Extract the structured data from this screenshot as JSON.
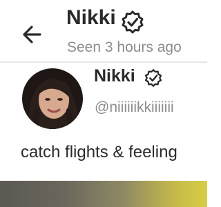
{
  "header": {
    "back_icon": "arrow-left-icon",
    "name": "Nikki",
    "verified_icon": "verified-badge-icon",
    "status": "Seen  3 hours ago"
  },
  "profile": {
    "avatar_icon": "avatar",
    "name": "Nikki",
    "verified_icon": "verified-badge-icon",
    "handle": "@niiiiiikkiiiiiii",
    "bio": "catch flights & feeling"
  },
  "colors": {
    "text_primary": "#2a2a2a",
    "text_secondary": "#8c8c8c",
    "divider": "#e6e6e6",
    "accent_yellow": "#d8cd45"
  }
}
